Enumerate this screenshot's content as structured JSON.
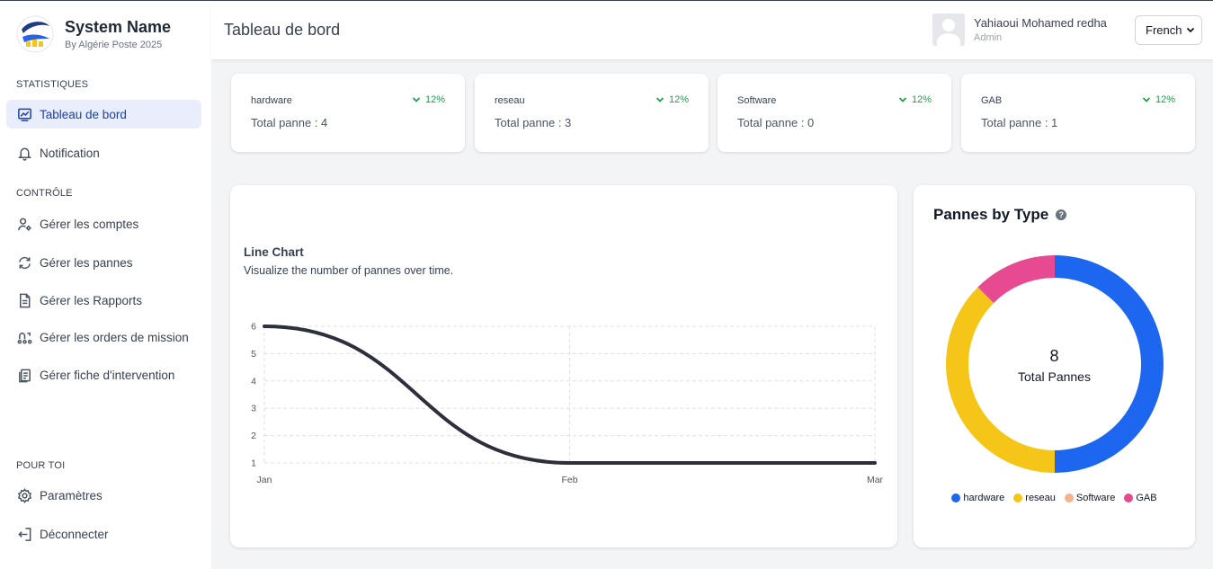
{
  "brand": {
    "name": "System Name",
    "subtitle": "By Algérie Poste 2025"
  },
  "sidebar": {
    "sections": [
      "STATISTIQUES",
      "CONTRÔLE",
      "POUR TOI"
    ],
    "items": [
      {
        "label": "Tableau de bord",
        "icon": "dashboard-chart-icon",
        "active": true
      },
      {
        "label": "Notification",
        "icon": "bell-icon"
      },
      {
        "label": "Gérer les comptes",
        "icon": "user-settings-icon"
      },
      {
        "label": "Gérer les pannes",
        "icon": "refresh-icon"
      },
      {
        "label": "Gérer les Rapports",
        "icon": "document-icon"
      },
      {
        "label": "Gérer les orders de mission",
        "icon": "route-icon"
      },
      {
        "label": "Gérer fiche d'intervention",
        "icon": "clipboard-icon"
      },
      {
        "label": "Paramètres",
        "icon": "gear-icon"
      },
      {
        "label": "Déconnecter",
        "icon": "logout-icon"
      }
    ]
  },
  "header": {
    "title": "Tableau de bord",
    "user": {
      "name": "Yahiaoui Mohamed redha",
      "role": "Admin"
    },
    "language": "French"
  },
  "cards": [
    {
      "title": "hardware",
      "total": "Total panne : 4",
      "trend": "12%"
    },
    {
      "title": "reseau",
      "total": "Total panne : 3",
      "trend": "12%"
    },
    {
      "title": "Software",
      "total": "Total panne : 0",
      "trend": "12%"
    },
    {
      "title": "GAB",
      "total": "Total panne : 1",
      "trend": "12%"
    }
  ],
  "line_panel": {
    "title": "Line Chart",
    "subtitle": "Visualize the number of pannes over time."
  },
  "donut_panel": {
    "title": "Pannes by Type",
    "center_value": "8",
    "center_label": "Total Pannes"
  },
  "colors": {
    "accent": "#1e40af",
    "trend_green": "#16a34a",
    "line": "#2d2f3b"
  },
  "chart_data": [
    {
      "type": "line",
      "title": "Line Chart",
      "subtitle": "Visualize the number of pannes over time.",
      "categories": [
        "Jan",
        "Feb",
        "Mar"
      ],
      "series": [
        {
          "values": [
            6,
            1,
            1
          ]
        }
      ],
      "ylim": [
        1,
        6
      ],
      "yticks": [
        1,
        2,
        3,
        4,
        5,
        6
      ],
      "grid": true
    },
    {
      "type": "pie",
      "title": "Pannes by Type",
      "labels": [
        "hardware",
        "reseau",
        "Software",
        "GAB"
      ],
      "values": [
        4,
        3,
        0,
        1
      ],
      "colors": [
        "#1d66f0",
        "#f5c518",
        "#f4b48a",
        "#e84a92"
      ],
      "legend": "bottom"
    }
  ]
}
